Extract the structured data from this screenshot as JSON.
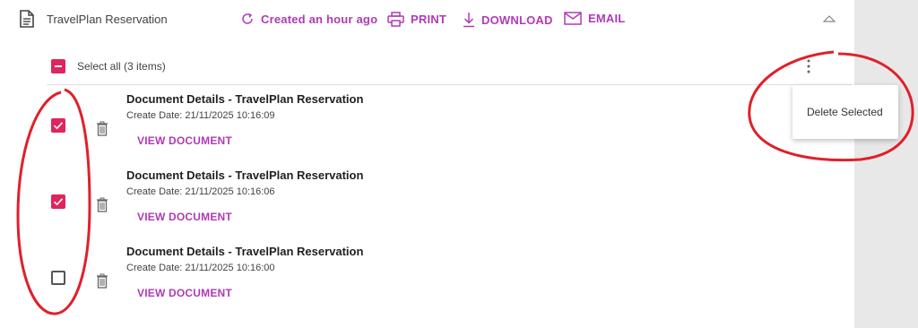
{
  "header": {
    "title": "TravelPlan Reservation",
    "created": "Created an hour ago",
    "print_label": "PRINT",
    "download_label": "DOWNLOAD",
    "email_label": "EMAIL"
  },
  "selection": {
    "select_all_label": "Select all (3 items)"
  },
  "menu": {
    "delete_selected_label": "Delete Selected"
  },
  "documents": [
    {
      "title": "Document Details - TravelPlan Reservation",
      "date": "Create Date: 21/11/2025 10:16:09",
      "view_label": "VIEW DOCUMENT",
      "checked": true
    },
    {
      "title": "Document Details - TravelPlan Reservation",
      "date": "Create Date: 21/11/2025 10:16:06",
      "view_label": "VIEW DOCUMENT",
      "checked": true
    },
    {
      "title": "Document Details - TravelPlan Reservation",
      "date": "Create Date: 21/11/2025 10:16:00",
      "view_label": "VIEW DOCUMENT",
      "checked": false
    }
  ],
  "colors": {
    "accent": "#b03ab5",
    "checkbox": "#e0245e",
    "annotation": "#e0202a",
    "gutter": "#e8e8e8"
  }
}
